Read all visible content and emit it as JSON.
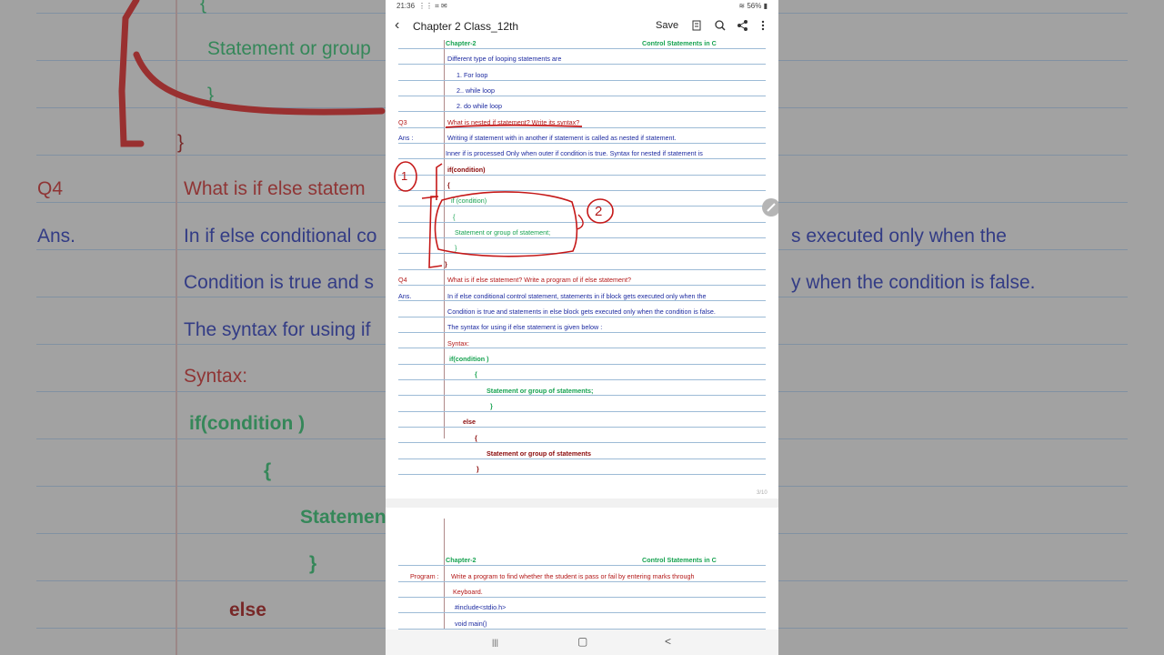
{
  "status_bar": {
    "time": "21:36",
    "left_icons": "⋮⋮ ⌗ ✉",
    "battery": "56%"
  },
  "app_bar": {
    "title": "Chapter 2 Class_12th",
    "save_label": "Save"
  },
  "background": {
    "q4": "Q4",
    "ans": "Ans.",
    "q4_text": "What is if else statem",
    "ans_text": "In if else conditional co",
    "ans_text_right": "s executed only when the",
    "cond_text": "Condition is true and s",
    "cond_text_right": "y when the condition is false.",
    "syntax_intro": "The syntax for using if",
    "syntax": "Syntax:",
    "if_cond": "if(condition )",
    "brace_open": "{",
    "statement": "Statemen",
    "brace_close": "}",
    "else": "else",
    "top_brace": "{",
    "top_statement": "Statement or group",
    "top_close": "}",
    "top_close2": "}"
  },
  "page1": {
    "header_left": "Chapter-2",
    "header_right": "Control Statements in C",
    "lines": [
      "Different type of looping statements are",
      "1.   For loop",
      "2.. while loop",
      "2.   do while loop"
    ],
    "q3_label": "Q3",
    "q3_text": "What is nested if statement? Write its syntax?",
    "ans_label": "Ans :",
    "ans_text": "Writing if statement with in another if statement is called as nested if statement.",
    "inner_text": "Inner if is processed Only when outer if condition is true. Syntax for nested if statement is",
    "outer_if": "if(condition)",
    "outer_open": "{",
    "inner_if": "if (condition)",
    "inner_open": "{",
    "inner_stmt": "Statement or group of statement;",
    "inner_close": "}",
    "outer_close": "}",
    "q4_label": "Q4",
    "q4_text": "What is if else statement? Write a program of if else statement?",
    "ans2_label": "Ans.",
    "ans2_text": "In if else conditional control statement, statements in if block gets executed only when the",
    "cond_text": "Condition is true and statements in else block gets executed only when the condition is false.",
    "syntax_intro": "The syntax for using if else statement is given below :",
    "syntax_label": "Syntax:",
    "if_cond": "if(condition )",
    "open1": "{",
    "stmt1": "Statement or group of statements;",
    "close1": "}",
    "else": "else",
    "open2": "{",
    "stmt2": "Statement or group of statements",
    "close2": "}",
    "page_number": "3/10",
    "annotation_1": "1",
    "annotation_2": "2"
  },
  "page2": {
    "header_left": "Chapter-2",
    "header_right": "Control Statements in C",
    "program_label": "Program :",
    "lines": [
      "Write a program to find whether the student is pass or fail by entering marks through",
      "Keyboard.",
      "#include<stdio.h>",
      "void main()"
    ]
  },
  "nav_bar": {
    "recents": "|||",
    "home": "▢",
    "back": "<"
  }
}
